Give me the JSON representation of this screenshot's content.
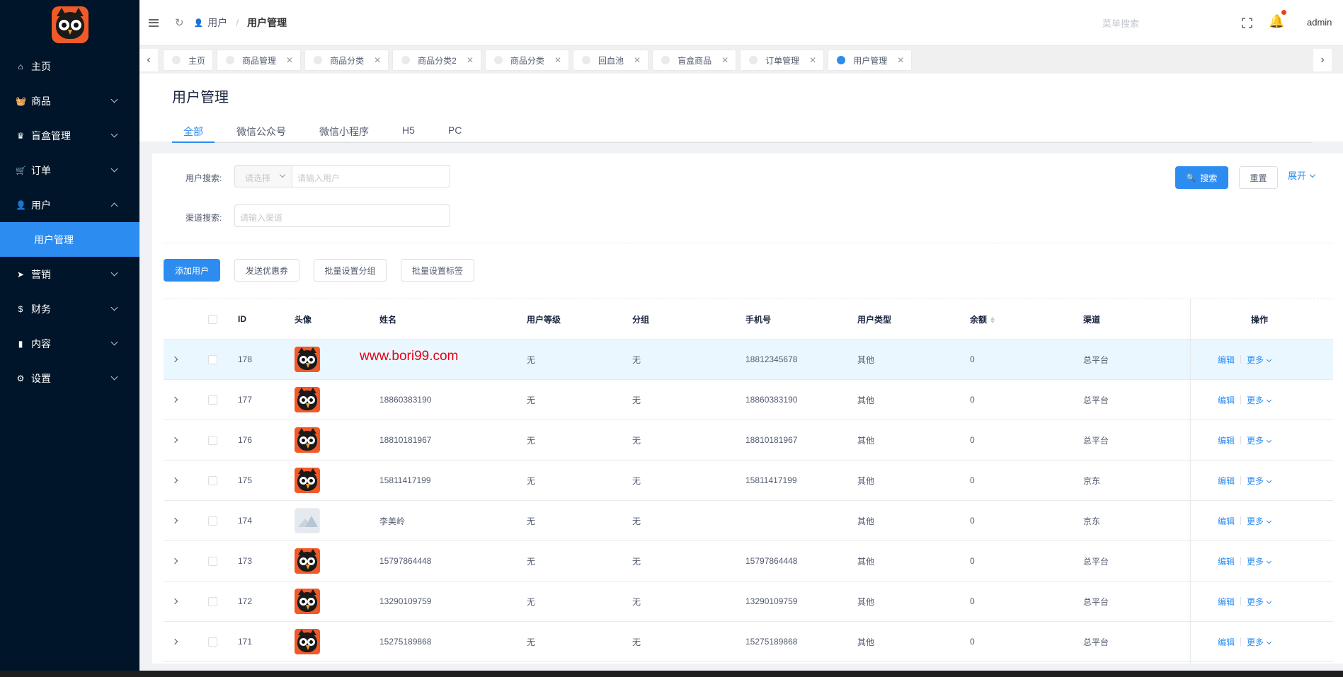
{
  "sidebar": {
    "items": [
      {
        "label": "主页",
        "icon": "home-icon",
        "glyph": "⌂",
        "has_arrow": false
      },
      {
        "label": "商品",
        "icon": "basket-icon",
        "glyph": "🧺",
        "has_arrow": true
      },
      {
        "label": "盲盒管理",
        "icon": "trophy-icon",
        "glyph": "♛",
        "has_arrow": true
      },
      {
        "label": "订单",
        "icon": "cart-icon",
        "glyph": "🛒",
        "has_arrow": true
      },
      {
        "label": "用户",
        "icon": "user-icon",
        "glyph": "👤",
        "has_arrow": true,
        "expanded": true
      },
      {
        "label": "营销",
        "icon": "send-icon",
        "glyph": "➤",
        "has_arrow": true
      },
      {
        "label": "财务",
        "icon": "dollar-icon",
        "glyph": "$",
        "has_arrow": true
      },
      {
        "label": "内容",
        "icon": "book-icon",
        "glyph": "▮",
        "has_arrow": true
      },
      {
        "label": "设置",
        "icon": "gear-icon",
        "glyph": "⚙",
        "has_arrow": true
      }
    ],
    "submenu_active": "用户管理"
  },
  "header": {
    "breadcrumb": [
      "用户",
      "用户管理"
    ],
    "breadcrumb_sep": "/",
    "menu_search_placeholder": "菜单搜索",
    "username": "admin"
  },
  "tabs": [
    {
      "label": "主页",
      "closable": false,
      "active": false
    },
    {
      "label": "商品管理",
      "closable": true,
      "active": false
    },
    {
      "label": "商品分类",
      "closable": true,
      "active": false
    },
    {
      "label": "商品分类2",
      "closable": true,
      "active": false
    },
    {
      "label": "商品分类",
      "closable": true,
      "active": false
    },
    {
      "label": "回血池",
      "closable": true,
      "active": false
    },
    {
      "label": "盲盒商品",
      "closable": true,
      "active": false
    },
    {
      "label": "订单管理",
      "closable": true,
      "active": false
    },
    {
      "label": "用户管理",
      "closable": true,
      "active": true
    }
  ],
  "page": {
    "title": "用户管理",
    "type_tabs": [
      "全部",
      "微信公众号",
      "微信小程序",
      "H5",
      "PC"
    ],
    "active_type_tab": 0
  },
  "filters": {
    "user_search_label": "用户搜索:",
    "select_placeholder": "请选择",
    "user_input_placeholder": "请输入用户",
    "channel_search_label": "渠道搜索:",
    "channel_input_placeholder": "请输入渠道",
    "search_button": "搜索",
    "reset_button": "重置",
    "expand_link": "展开"
  },
  "actions": {
    "add_user": "添加用户",
    "send_coupon": "发送优惠券",
    "batch_group": "批量设置分组",
    "batch_tag": "批量设置标签"
  },
  "table": {
    "columns": {
      "id": "ID",
      "avatar": "头像",
      "name": "姓名",
      "level": "用户等级",
      "group": "分组",
      "phone": "手机号",
      "type": "用户类型",
      "balance": "余额",
      "channel": "渠道",
      "ops": "操作"
    },
    "op_edit": "编辑",
    "op_more": "更多",
    "rows": [
      {
        "id": "178",
        "avatar": "owl",
        "name": "",
        "level": "无",
        "group": "无",
        "phone": "18812345678",
        "type": "其他",
        "balance": "0",
        "channel": "总平台",
        "highlight": true
      },
      {
        "id": "177",
        "avatar": "owl",
        "name": "18860383190",
        "level": "无",
        "group": "无",
        "phone": "18860383190",
        "type": "其他",
        "balance": "0",
        "channel": "总平台"
      },
      {
        "id": "176",
        "avatar": "owl",
        "name": "18810181967",
        "level": "无",
        "group": "无",
        "phone": "18810181967",
        "type": "其他",
        "balance": "0",
        "channel": "总平台"
      },
      {
        "id": "175",
        "avatar": "owl",
        "name": "15811417199",
        "level": "无",
        "group": "无",
        "phone": "15811417199",
        "type": "其他",
        "balance": "0",
        "channel": "京东"
      },
      {
        "id": "174",
        "avatar": "placeholder",
        "name": "李美岭",
        "level": "无",
        "group": "无",
        "phone": "",
        "type": "其他",
        "balance": "0",
        "channel": "京东"
      },
      {
        "id": "173",
        "avatar": "owl",
        "name": "15797864448",
        "level": "无",
        "group": "无",
        "phone": "15797864448",
        "type": "其他",
        "balance": "0",
        "channel": "总平台"
      },
      {
        "id": "172",
        "avatar": "owl",
        "name": "13290109759",
        "level": "无",
        "group": "无",
        "phone": "13290109759",
        "type": "其他",
        "balance": "0",
        "channel": "总平台"
      },
      {
        "id": "171",
        "avatar": "owl",
        "name": "15275189868",
        "level": "无",
        "group": "无",
        "phone": "15275189868",
        "type": "其他",
        "balance": "0",
        "channel": "总平台"
      }
    ]
  },
  "watermark": "www.bori99.com",
  "colors": {
    "sidebar_bg": "#001529",
    "primary": "#2d8cf0",
    "brand_orange": "#f05a28",
    "row_highlight": "#ebf7ff",
    "watermark_red": "#e60012"
  }
}
